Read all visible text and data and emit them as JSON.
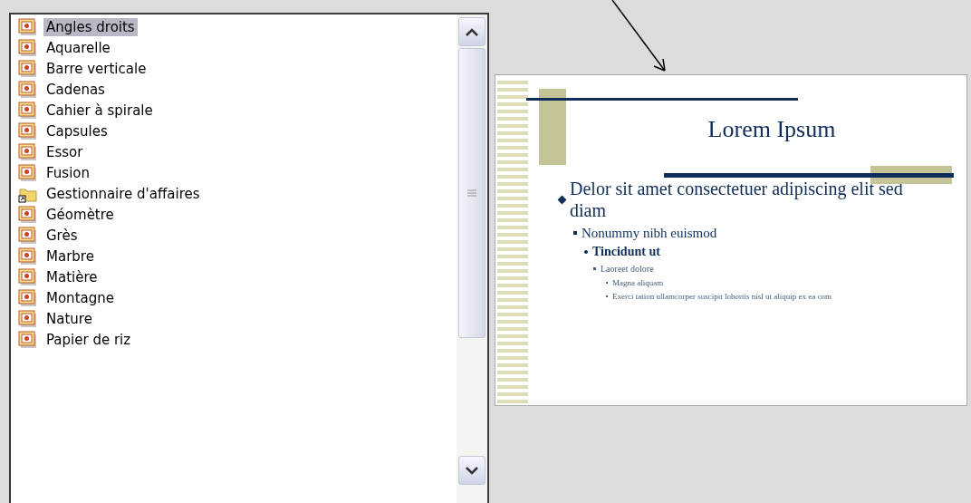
{
  "template_list": {
    "items": [
      {
        "label": "Angles droits",
        "kind": "template",
        "selected": true
      },
      {
        "label": "Aquarelle",
        "kind": "template",
        "selected": false
      },
      {
        "label": "Barre verticale",
        "kind": "template",
        "selected": false
      },
      {
        "label": "Cadenas",
        "kind": "template",
        "selected": false
      },
      {
        "label": "Cahier à spirale",
        "kind": "template",
        "selected": false
      },
      {
        "label": "Capsules",
        "kind": "template",
        "selected": false
      },
      {
        "label": "Essor",
        "kind": "template",
        "selected": false
      },
      {
        "label": "Fusion",
        "kind": "template",
        "selected": false
      },
      {
        "label": "Gestionnaire d'affaires",
        "kind": "folder",
        "selected": false
      },
      {
        "label": "Géomètre",
        "kind": "template",
        "selected": false
      },
      {
        "label": "Grès",
        "kind": "template",
        "selected": false
      },
      {
        "label": "Marbre",
        "kind": "template",
        "selected": false
      },
      {
        "label": "Matière",
        "kind": "template",
        "selected": false
      },
      {
        "label": "Montagne",
        "kind": "template",
        "selected": false
      },
      {
        "label": "Nature",
        "kind": "template",
        "selected": false
      },
      {
        "label": "Papier de riz",
        "kind": "template",
        "selected": false
      }
    ]
  },
  "preview": {
    "title": "Lorem Ipsum",
    "bullets": [
      {
        "text": "Delor sit amet consectetuer adipiscing elit sed diam",
        "children": [
          {
            "text": "Nonummy nibh euismod",
            "children": [
              {
                "text": "Tincidunt ut",
                "children": [
                  {
                    "text": "Laoreet dolore",
                    "children": [
                      {
                        "text": "Magna aliquam"
                      },
                      {
                        "text": "Exerci tation ullamcorper suscipit lobortis nisl ut aliquip ex ea com"
                      }
                    ]
                  }
                ]
              }
            ]
          }
        ]
      }
    ]
  }
}
